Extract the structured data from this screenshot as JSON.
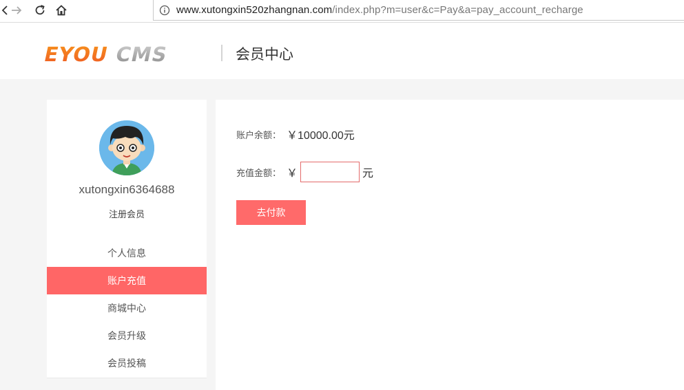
{
  "browser": {
    "url_host": "www.xutongxin520zhangnan.com",
    "url_path": "/index.php?m=user&c=Pay&a=pay_account_recharge"
  },
  "header": {
    "logo_text": "EYOUCMS",
    "title": "会员中心"
  },
  "sidebar": {
    "username": "xutongxin6364688",
    "level": "注册会员",
    "items": [
      {
        "label": "个人信息",
        "active": false
      },
      {
        "label": "账户充值",
        "active": true
      },
      {
        "label": "商城中心",
        "active": false
      },
      {
        "label": "会员升级",
        "active": false
      },
      {
        "label": "会员投稿",
        "active": false
      }
    ]
  },
  "main": {
    "balance_label": "账户余额：",
    "balance_value": "￥10000.00元",
    "recharge_label": "充值金额：",
    "currency_symbol": "￥",
    "amount_value": "",
    "amount_unit": "元",
    "pay_button": "去付款"
  },
  "colors": {
    "accent": "#ff6666",
    "logo_orange": "#f26522",
    "logo_gray": "#a8a8a8",
    "avatar_bg": "#6bb8ea"
  }
}
